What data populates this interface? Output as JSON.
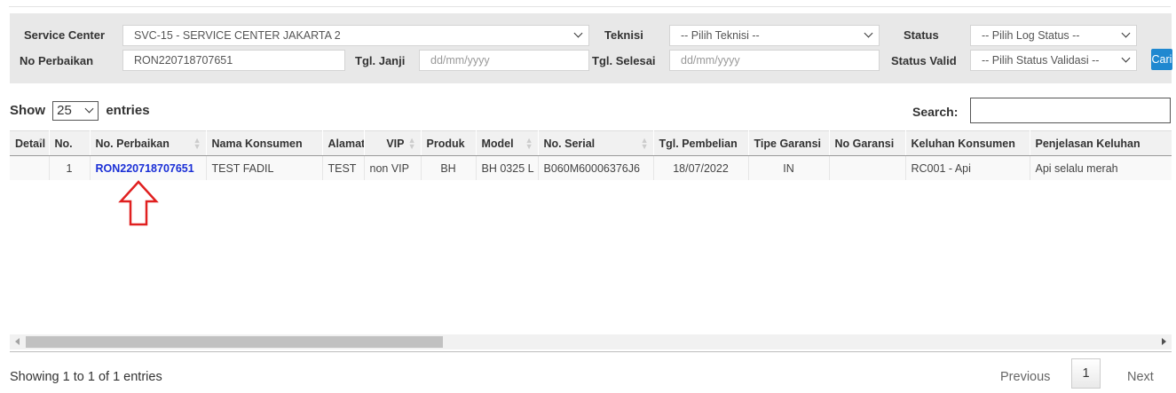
{
  "filter": {
    "service_center_label": "Service Center",
    "service_center_value": "SVC-15 - SERVICE CENTER JAKARTA 2",
    "teknisi_label": "Teknisi",
    "teknisi_value": "-- Pilih Teknisi --",
    "status_label": "Status",
    "status_value": "-- Pilih Log Status --",
    "no_perbaikan_label": "No Perbaikan",
    "no_perbaikan_value": "RON220718707651",
    "tgl_janji_label": "Tgl. Janji",
    "tgl_janji_placeholder": "dd/mm/yyyy",
    "tgl_selesai_label": "Tgl. Selesai",
    "tgl_selesai_placeholder": "dd/mm/yyyy",
    "status_valid_label": "Status Valid",
    "status_valid_value": "-- Pilih Status Validasi --",
    "cari_label": "Cari"
  },
  "length": {
    "show_label": "Show",
    "value": "25",
    "entries_label": "entries"
  },
  "search": {
    "label": "Search:",
    "value": ""
  },
  "table": {
    "headers": [
      "Detail",
      "No.",
      "No. Perbaikan",
      "Nama Konsumen",
      "Alamat",
      "VIP",
      "Produk",
      "Model",
      "No. Serial",
      "Tgl. Pembelian",
      "Tipe Garansi",
      "No Garansi",
      "Keluhan Konsumen",
      "Penjelasan Keluhan"
    ],
    "rows": [
      {
        "detail": "",
        "no": "1",
        "no_perbaikan": "RON220718707651",
        "nama_konsumen": "TEST FADIL",
        "alamat": "TEST",
        "vip": "non VIP",
        "produk": "BH",
        "model": "BH 0325 L",
        "no_serial": "B060M60006376J6",
        "tgl_pembelian": "18/07/2022",
        "tipe_garansi": "IN",
        "no_garansi": "",
        "keluhan_konsumen": "RC001 - Api",
        "penjelasan_keluhan": "Api selalu merah"
      }
    ]
  },
  "info": "Showing 1 to 1 of 1 entries",
  "pagination": {
    "previous": "Previous",
    "current": "1",
    "next": "Next"
  },
  "colors": {
    "link": "#1a2fd6",
    "arrow": "#e02020",
    "button": "#1f88d0",
    "panel": "#e8e8e8"
  },
  "icons": {
    "annotation": "up-arrow-icon",
    "select": "chevron-down-icon"
  }
}
